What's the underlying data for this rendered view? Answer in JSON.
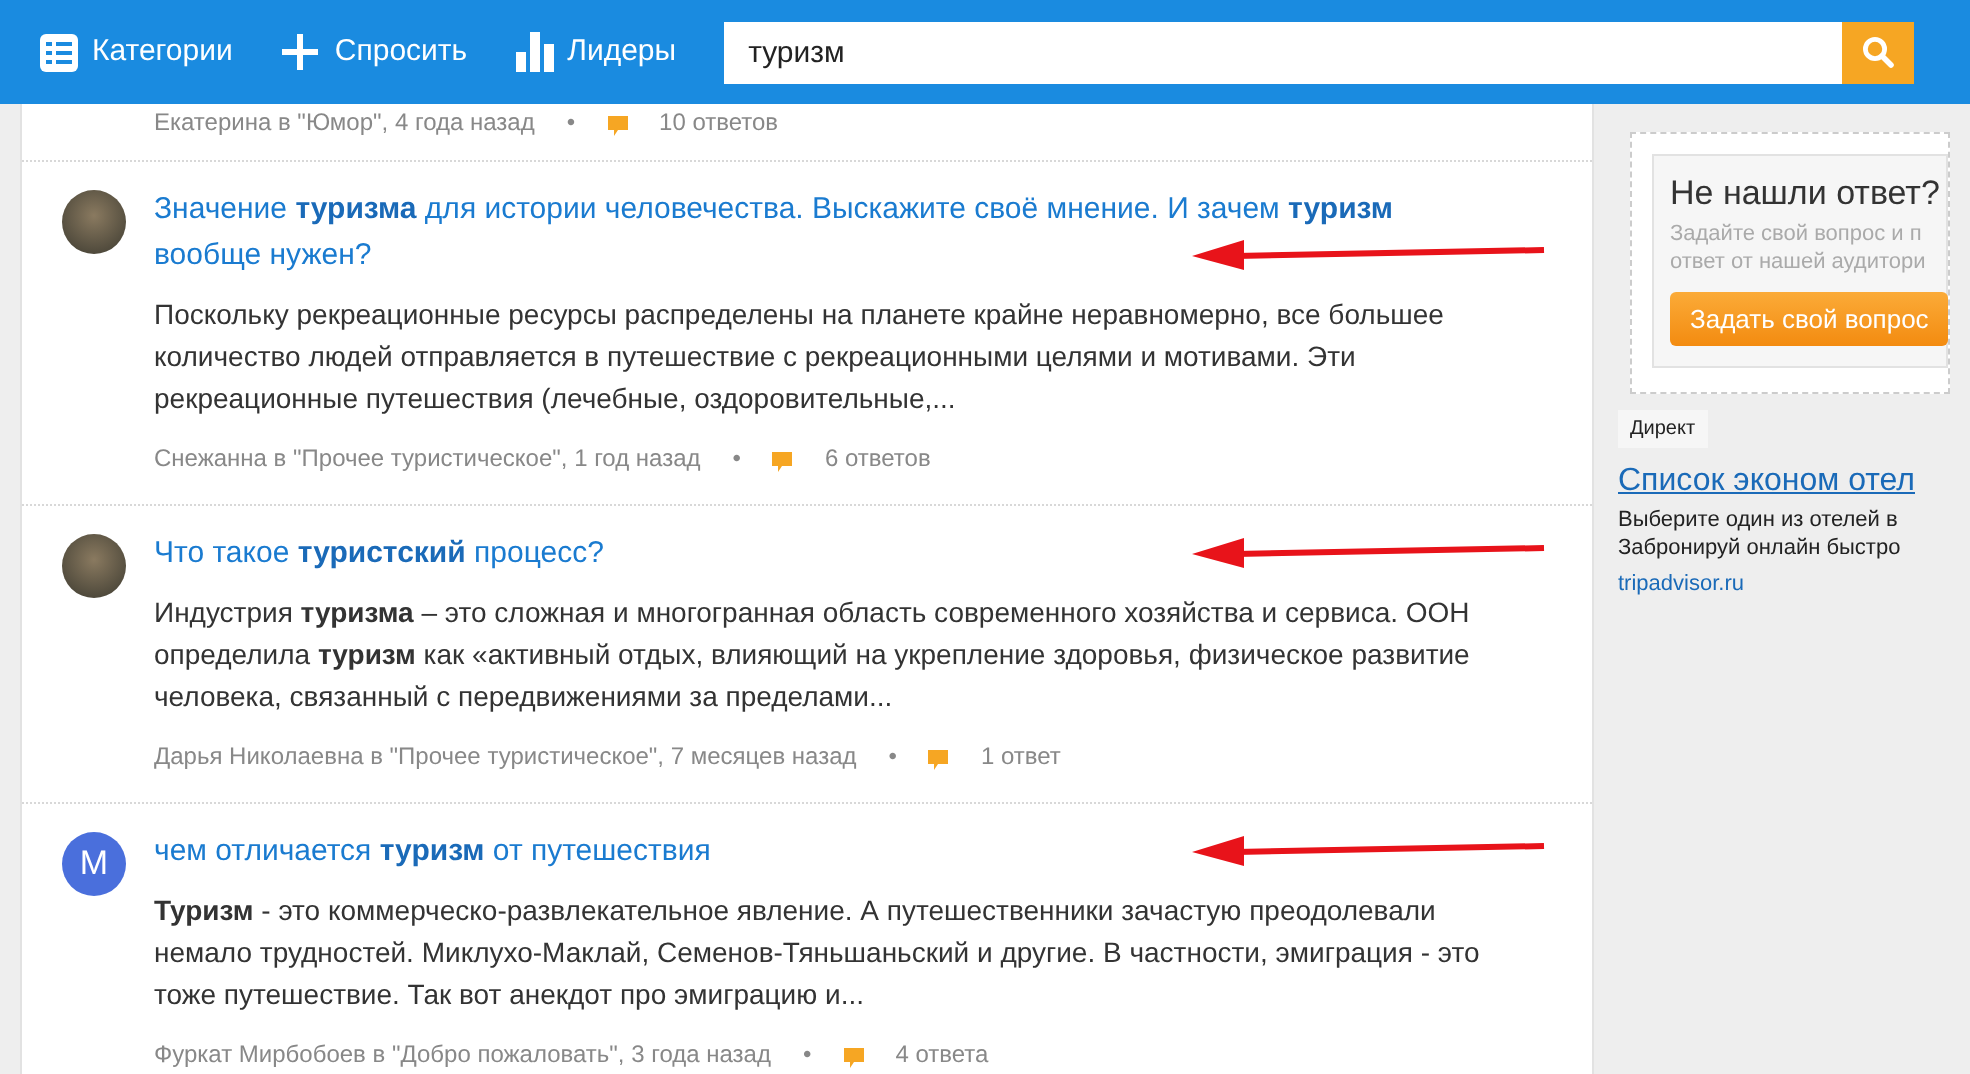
{
  "header": {
    "nav": [
      {
        "label": "Категории"
      },
      {
        "label": "Спросить"
      },
      {
        "label": "Лидеры"
      }
    ],
    "search": {
      "value": "туризм"
    }
  },
  "questions": [
    {
      "author_meta": "Екатерина в \"Юмор\", 4 года назад",
      "separator": "•",
      "answers": "10 ответов"
    },
    {
      "title": "Значение **туризма** для истории человечества. Выскажите своё мнение. И зачем **туризм** вообще нужен?",
      "snippet": "Поскольку рекреационные ресурсы распределены на планете крайне неравномерно, все большее количество людей отправляется в путешествие с рекреационными целями и мотивами. Эти рекреационные путешествия (лечебные, оздоровительные,...",
      "author_meta": "Снежанна в \"Прочее туристическое\", 1 год назад",
      "separator": "•",
      "answers": "6 ответов",
      "avatar": {
        "kind": "photo"
      },
      "arrow": true
    },
    {
      "title": "Что такое **туристский** процесс?",
      "snippet": "Индустрия **туризма** – это сложная и многогранная область современного хозяйства и сервиса. ООН определила **туризм** как «активный отдых, влияющий на укрепление здоровья, физическое развитие человека, связанный с передвижениями за пределами...",
      "author_meta": "Дарья Николаевна в \"Прочее туристическое\", 7 месяцев назад",
      "separator": "•",
      "answers": "1 ответ",
      "avatar": {
        "kind": "photo"
      },
      "arrow": true
    },
    {
      "title": "чем отличается **туризм** от путешествия",
      "snippet": "**Туризм** - это коммерческо-развлекательное явление. А путешественники зачастую преодолевали немало трудностей. Миклухо-Маклай, Семенов-Тяньшаньский и другие. В частности, эмиграция - это тоже путешествие. Так вот анекдот про эмиграцию и...",
      "author_meta": "Фуркат Мирбобоев в \"Добро пожаловать\", 3 года назад",
      "separator": "•",
      "answers": "4 ответа",
      "avatar": {
        "kind": "letter",
        "letter": "M",
        "color": "#4a6fdc"
      },
      "arrow": true
    }
  ],
  "sidebar": {
    "prompt": {
      "title": "Не нашли ответ?",
      "text_lines": [
        "Задайте свой вопрос и п",
        "ответ от нашей аудитори"
      ],
      "button": "Задать свой вопрос"
    },
    "ad": {
      "label": "Директ",
      "link": "Список эконом отел",
      "lines": [
        "Выберите один из отелей в",
        "Забронируй онлайн быстро"
      ],
      "domain": "tripadvisor.ru"
    }
  }
}
